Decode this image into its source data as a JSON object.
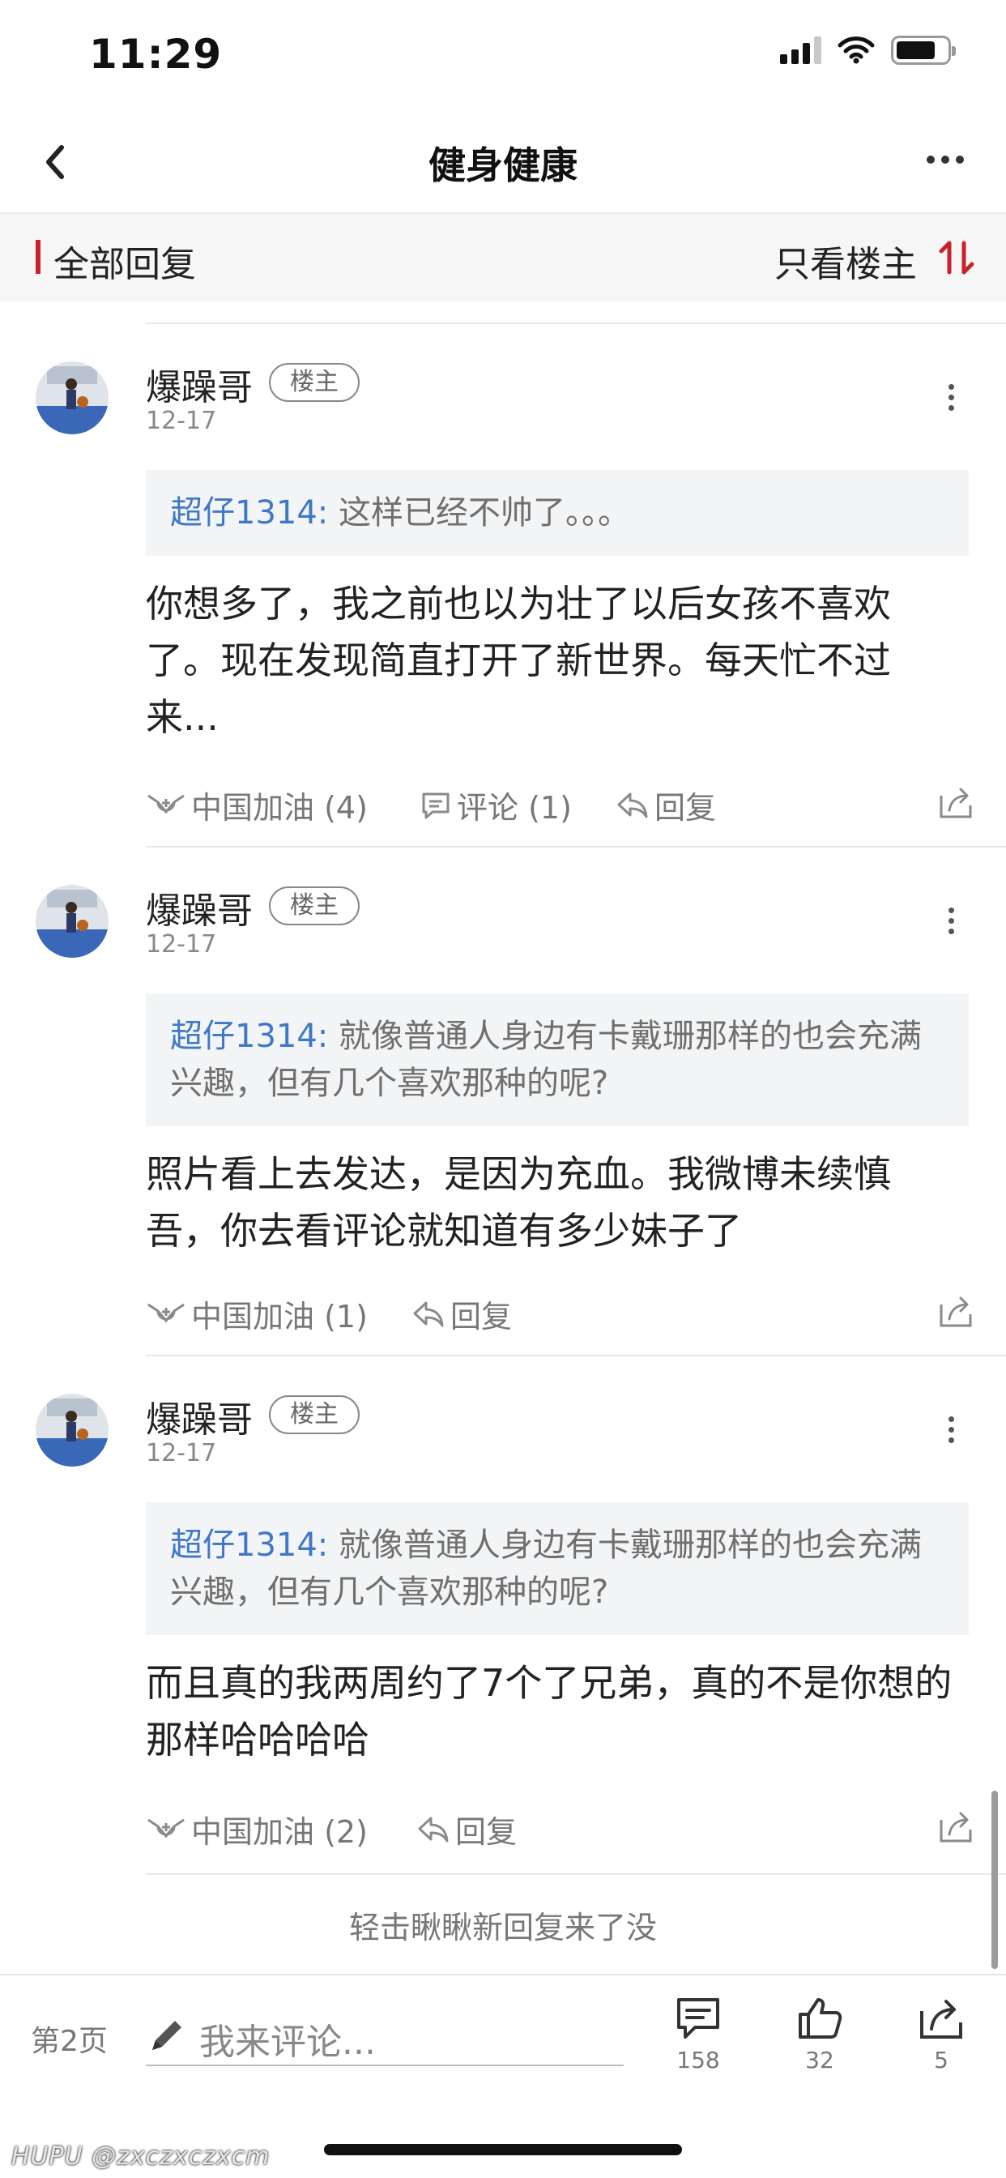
{
  "status_bar": {
    "time": "11:29"
  },
  "nav": {
    "title": "健身健康"
  },
  "filter": {
    "all_replies": "全部回复",
    "only_op": "只看楼主"
  },
  "replies": [
    {
      "user": "爆躁哥",
      "badge": "楼主",
      "date": "12-17",
      "quote_author": "超仔1314:",
      "quote_text": "这样已经不帅了。。。",
      "text": "你想多了，我之前也以为壮了以后女孩不喜欢了。现在发现简直打开了新世界。每天忙不过来...",
      "like_label": "中国加油 (4)",
      "comment_label": "评论 (1)",
      "reply_label": "回复"
    },
    {
      "user": "爆躁哥",
      "badge": "楼主",
      "date": "12-17",
      "quote_author": "超仔1314:",
      "quote_text": "就像普通人身边有卡戴珊那样的也会充满兴趣，但有几个喜欢那种的呢?",
      "text": "照片看上去发达，是因为充血。我微博未续慎吾，你去看评论就知道有多少妹子了",
      "like_label": "中国加油 (1)",
      "reply_label": "回复"
    },
    {
      "user": "爆躁哥",
      "badge": "楼主",
      "date": "12-17",
      "quote_author": "超仔1314:",
      "quote_text": "就像普通人身边有卡戴珊那样的也会充满兴趣，但有几个喜欢那种的呢?",
      "text": "而且真的我两周约了7个了兄弟，真的不是你想的那样哈哈哈哈",
      "like_label": "中国加油 (2)",
      "reply_label": "回复"
    }
  ],
  "load_new": "轻击瞅瞅新回复来了没",
  "bottom_bar": {
    "page": "第2页",
    "comment_placeholder": "我来评论...",
    "comments_count": "158",
    "likes_count": "32",
    "shares_count": "5"
  },
  "watermark": "HUPU @zxczxczxcm",
  "colors": {
    "accent_red": "#c8232c",
    "quote_blue": "#3e78c6"
  }
}
